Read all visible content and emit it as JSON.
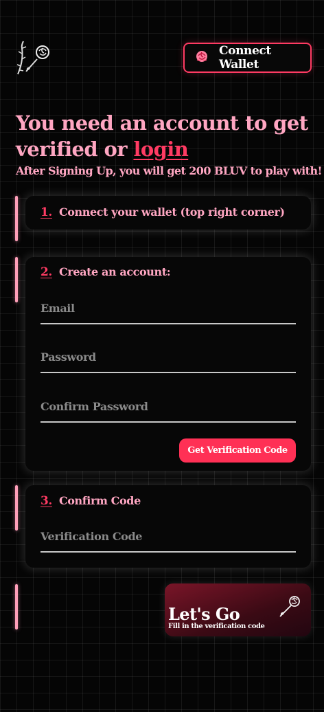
{
  "header": {
    "connect_wallet_label": "Connect Wallet"
  },
  "intro": {
    "heading_text": "You need an account to get verified or ",
    "login_link": "login",
    "subheading": "After Signing Up, you will get 200 BLUV to play with!"
  },
  "steps": [
    {
      "number": "1.",
      "title": "Connect your wallet (top right corner)"
    },
    {
      "number": "2.",
      "title": "Create an account:"
    },
    {
      "number": "3.",
      "title": "Confirm Code"
    }
  ],
  "form": {
    "email_placeholder": "Email",
    "email_value": "",
    "password_placeholder": "Password",
    "password_value": "",
    "confirm_password_placeholder": "Confirm Password",
    "confirm_password_value": "",
    "verification_code_placeholder": "Verification Code",
    "verification_code_value": "",
    "get_code_label": "Get Verification Code"
  },
  "cta": {
    "title": "Let's Go",
    "subtitle": "Fill in the verification code"
  },
  "colors": {
    "accent": "#ff3b63",
    "pink_text": "#ffa6c2",
    "background": "#050505"
  },
  "icons": {
    "logo": "rose-thorn-logo-icon",
    "wallet": "rose-icon",
    "cta": "rose-icon"
  }
}
